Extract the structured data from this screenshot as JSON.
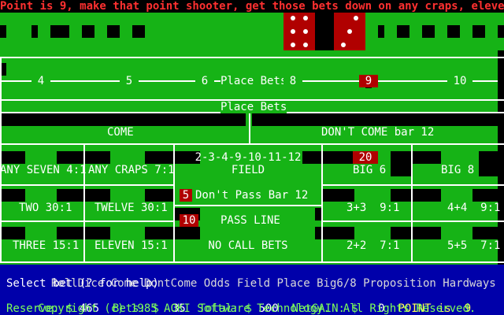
{
  "banner": {
    "message": "Point is 9, make that point shooter, get those bets down on any craps, eleven!"
  },
  "dice": {
    "die1": 6,
    "die2": 3
  },
  "place_numbers": [
    "4",
    "5",
    "6",
    "8",
    "9",
    "10"
  ],
  "place_bets_label": "Place Bets",
  "place_bets_label_2": "Place Bets",
  "come": {
    "label": "COME"
  },
  "dont_come": {
    "label": "DON'T COME bar 12"
  },
  "any_seven": {
    "label": "ANY SEVEN 4:1"
  },
  "any_craps": {
    "label": "ANY CRAPS 7:1"
  },
  "field": {
    "numbers": "2-3-4-9-10-11-12",
    "label": "FIELD"
  },
  "big6": {
    "label": "BIG 6",
    "bet": "20"
  },
  "big8": {
    "label": "BIG 8"
  },
  "two": {
    "label": "TWO 30:1"
  },
  "twelve": {
    "label": "TWELVE 30:1"
  },
  "dont_pass": {
    "bet": "5",
    "label": "Don't Pass Bar 12"
  },
  "pass_line": {
    "bet": "10",
    "label": "PASS LINE"
  },
  "hard6": {
    "label": "3+3  9:1"
  },
  "hard8": {
    "label": "4+4  9:1"
  },
  "three": {
    "label": "THREE 15:1"
  },
  "eleven": {
    "label": "ELEVEN 15:1"
  },
  "no_call": {
    "label": "NO CALL BETS"
  },
  "hard4": {
    "label": "2+2  7:1"
  },
  "hard10": {
    "label": "5+5  7:1"
  },
  "menu": {
    "items": [
      "RollDice",
      "Come",
      "DontCome",
      "Odds",
      "Field",
      "Place",
      "Big6/8",
      "Proposition",
      "Hardways"
    ]
  },
  "prompt": "Select bet (? for help)",
  "status": {
    "reserve_label": "Reserve: $",
    "reserve": "465",
    "bets_label": "Bets: $",
    "bets": "35",
    "total_label": "Total: $",
    "total": "500",
    "netgain_label": "NetGAIN: $",
    "netgain": "0",
    "point_label": "POINT is",
    "point": "9"
  },
  "copyright": "Copyright (c) 1985 AOKI Software Technology.  All Rights Reserved.",
  "colors": {
    "felt": "#16b316",
    "banner_text": "#ff3030",
    "menu_bg": "#0000aa",
    "status_text": "#7dff5a",
    "bet_marker": "#b00000"
  }
}
